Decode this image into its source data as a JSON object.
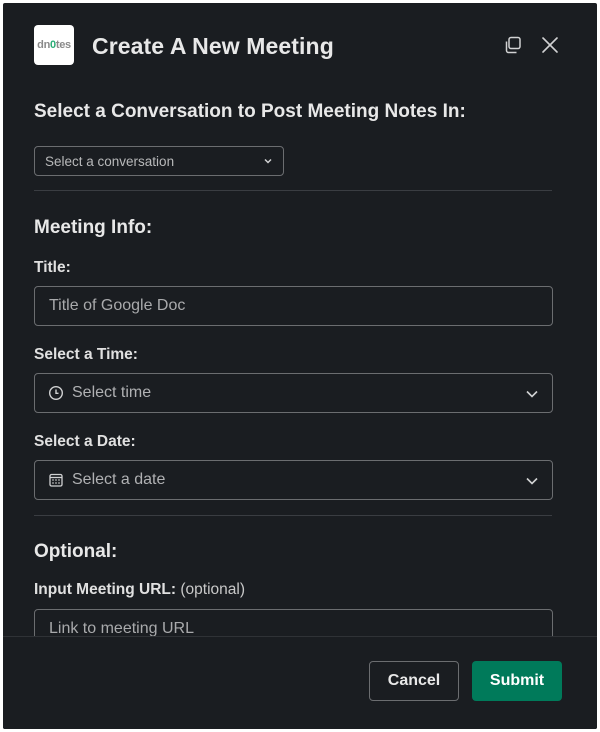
{
  "app": {
    "logo_text_a": "dn",
    "logo_text_b": "0",
    "logo_text_c": "tes"
  },
  "modal": {
    "title": "Create A New Meeting",
    "copy_icon": "copy-icon",
    "close_icon": "close-icon"
  },
  "conversation": {
    "heading": "Select a Conversation to Post Meeting Notes In:",
    "select_placeholder": "Select a conversation"
  },
  "meeting_info": {
    "heading": "Meeting Info:",
    "title_label": "Title:",
    "title_placeholder": "Title of Google Doc",
    "time_label": "Select a Time:",
    "time_placeholder": "Select time",
    "date_label": "Select a Date:",
    "date_placeholder": "Select a date"
  },
  "optional": {
    "heading": "Optional:",
    "url_label": "Input Meeting URL:",
    "url_label_suffix": "(optional)",
    "url_placeholder": "Link to meeting URL"
  },
  "footer": {
    "cancel_label": "Cancel",
    "submit_label": "Submit"
  },
  "colors": {
    "background": "#1a1d21",
    "submit": "#007a5a",
    "logo_accent": "#2bac76"
  }
}
